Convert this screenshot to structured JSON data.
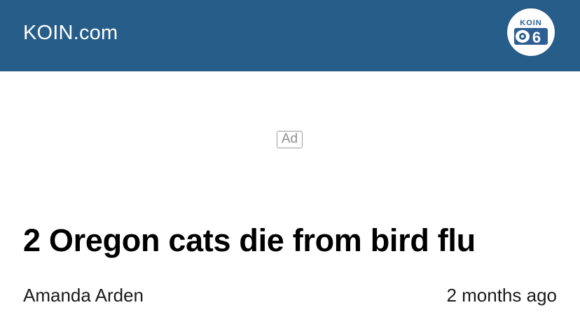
{
  "header": {
    "site_name": "KOIN.com",
    "logo_text": "KOIN",
    "logo_channel": "6",
    "background_color": "#265d89",
    "logo_icon": "koin-6-logo-icon"
  },
  "ad": {
    "label": "Ad"
  },
  "article": {
    "headline": "2 Oregon cats die from bird flu",
    "author": "Amanda Arden",
    "timestamp": "2 months ago"
  }
}
